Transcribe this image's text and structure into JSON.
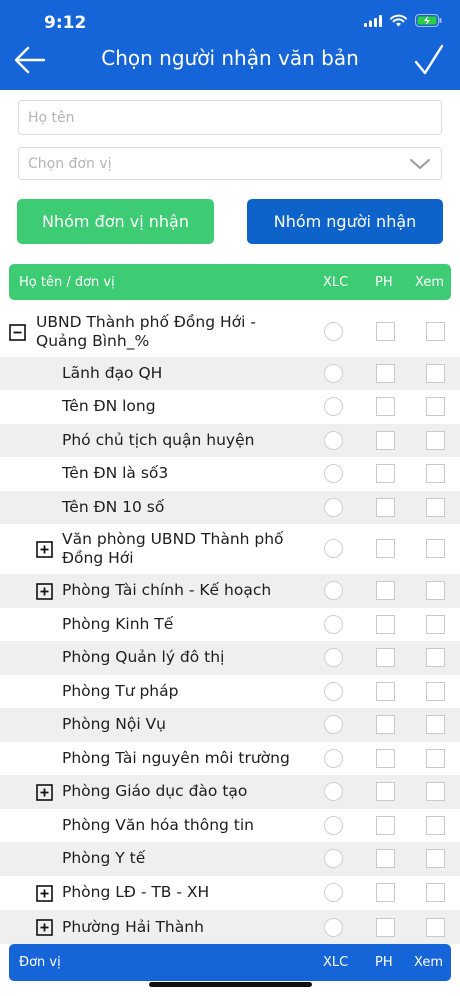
{
  "status_bar": {
    "time": "9:12"
  },
  "header": {
    "title": "Chọn người nhận văn bản"
  },
  "search": {
    "name_placeholder": "Họ tên",
    "unit_placeholder": "Chọn đơn vị"
  },
  "buttons": {
    "unit_group": "Nhóm đơn vị nhận",
    "recipient_group": "Nhóm người nhận"
  },
  "table": {
    "header": {
      "name": "Họ tên / đơn vị",
      "xlc": "XLC",
      "ph": "PH",
      "xem": "Xem"
    },
    "footer": {
      "name": "Đơn vị",
      "xlc": "XLC",
      "ph": "PH",
      "xem": "Xem"
    },
    "rows": [
      {
        "label": "UBND Thành phố Đồng Hới - Quảng Bình_%",
        "level": 0,
        "expander": "minus",
        "alt": false
      },
      {
        "label": "Lãnh đạo QH",
        "level": 1,
        "expander": "",
        "alt": true
      },
      {
        "label": "Tên ĐN long",
        "level": 1,
        "expander": "",
        "alt": false
      },
      {
        "label": "Phó chủ tịch quận huyện",
        "level": 1,
        "expander": "",
        "alt": true
      },
      {
        "label": "Tên ĐN là số3",
        "level": 1,
        "expander": "",
        "alt": false
      },
      {
        "label": "Tên ĐN 10 số",
        "level": 1,
        "expander": "",
        "alt": true
      },
      {
        "label": "Văn phòng UBND Thành phố Đồng Hới",
        "level": 1,
        "expander": "plus",
        "alt": false
      },
      {
        "label": "Phòng Tài chính - Kế hoạch",
        "level": 1,
        "expander": "plus",
        "alt": true
      },
      {
        "label": "Phòng Kinh Tế",
        "level": 1,
        "expander": "",
        "alt": false
      },
      {
        "label": "Phòng Quản lý đô thị",
        "level": 1,
        "expander": "",
        "alt": true
      },
      {
        "label": "Phòng Tư pháp",
        "level": 1,
        "expander": "",
        "alt": false
      },
      {
        "label": "Phòng Nội Vụ",
        "level": 1,
        "expander": "",
        "alt": true
      },
      {
        "label": "Phòng Tài nguyên môi trường",
        "level": 1,
        "expander": "",
        "alt": false
      },
      {
        "label": "Phòng Giáo dục đào tạo",
        "level": 1,
        "expander": "plus",
        "alt": true
      },
      {
        "label": "Phòng Văn hóa thông tin",
        "level": 1,
        "expander": "",
        "alt": false
      },
      {
        "label": "Phòng Y tế",
        "level": 1,
        "expander": "",
        "alt": true
      },
      {
        "label": "Phòng LĐ - TB - XH",
        "level": 1,
        "expander": "plus",
        "alt": false
      },
      {
        "label": "Phường Hải Thành",
        "level": 1,
        "expander": "plus",
        "alt": true
      }
    ]
  },
  "colors": {
    "primary_blue": "#1565d8",
    "button_blue": "#0d63c9",
    "green": "#3dcb74",
    "row_alt": "#efefef"
  },
  "icons": {
    "back": "arrow-left-icon",
    "done": "checkmark-icon",
    "chevron": "chevron-down-icon",
    "signal": "signal-icon",
    "wifi": "wifi-icon",
    "battery": "battery-charging-icon",
    "expand": "plus-square-icon",
    "collapse": "minus-square-icon"
  }
}
